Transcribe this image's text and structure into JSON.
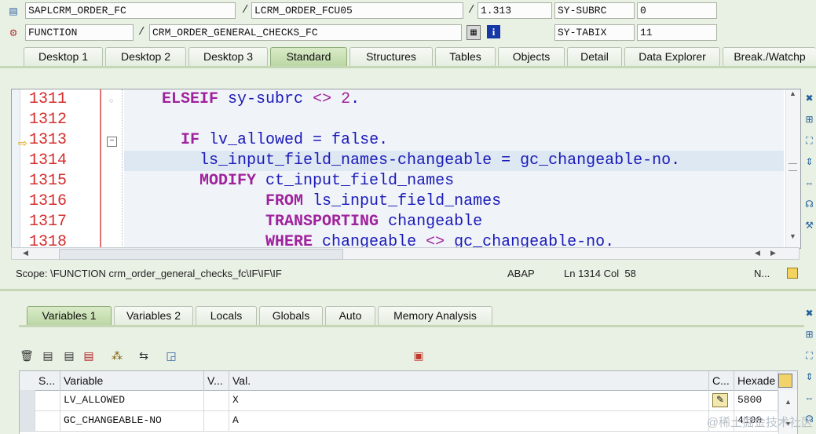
{
  "header": {
    "row1": {
      "program": "SAPLCRM_ORDER_FC",
      "include": "LCRM_ORDER_FCU05",
      "line": "1.313",
      "sysvar_name": "SY-SUBRC",
      "sysvar_value": "0"
    },
    "row2": {
      "type": "FUNCTION",
      "name": "CRM_ORDER_GENERAL_CHECKS_FC",
      "sysvar_name": "SY-TABIX",
      "sysvar_value": "11"
    },
    "slash": "/"
  },
  "tabs": [
    "Desktop 1",
    "Desktop 2",
    "Desktop 3",
    "Standard",
    "Structures",
    "Tables",
    "Objects",
    "Detail",
    "Data Explorer",
    "Break./Watchp"
  ],
  "editor": {
    "line_numbers": [
      "1311",
      "1312",
      "1313",
      "1314",
      "1315",
      "1316",
      "1317",
      "1318"
    ]
  },
  "status": {
    "scope": "Scope: \\FUNCTION crm_order_general_checks_fc\\IF\\IF\\IF",
    "lang": "ABAP",
    "pos": "Ln 1314 Col  58",
    "mode": "N..."
  },
  "variable_tabs": [
    "Variables 1",
    "Variables 2",
    "Locals",
    "Globals",
    "Auto",
    "Memory Analysis"
  ],
  "grid": {
    "headers": [
      "S...",
      "Variable",
      "V...",
      "Val.",
      "C...",
      "Hexade"
    ],
    "rows": [
      {
        "variable": "LV_ALLOWED",
        "value": "X",
        "hex": "5800"
      },
      {
        "variable": "GC_CHANGEABLE-NO",
        "value": "A",
        "hex": "4100"
      }
    ]
  },
  "watermark": "@稀土掘金技术社区"
}
